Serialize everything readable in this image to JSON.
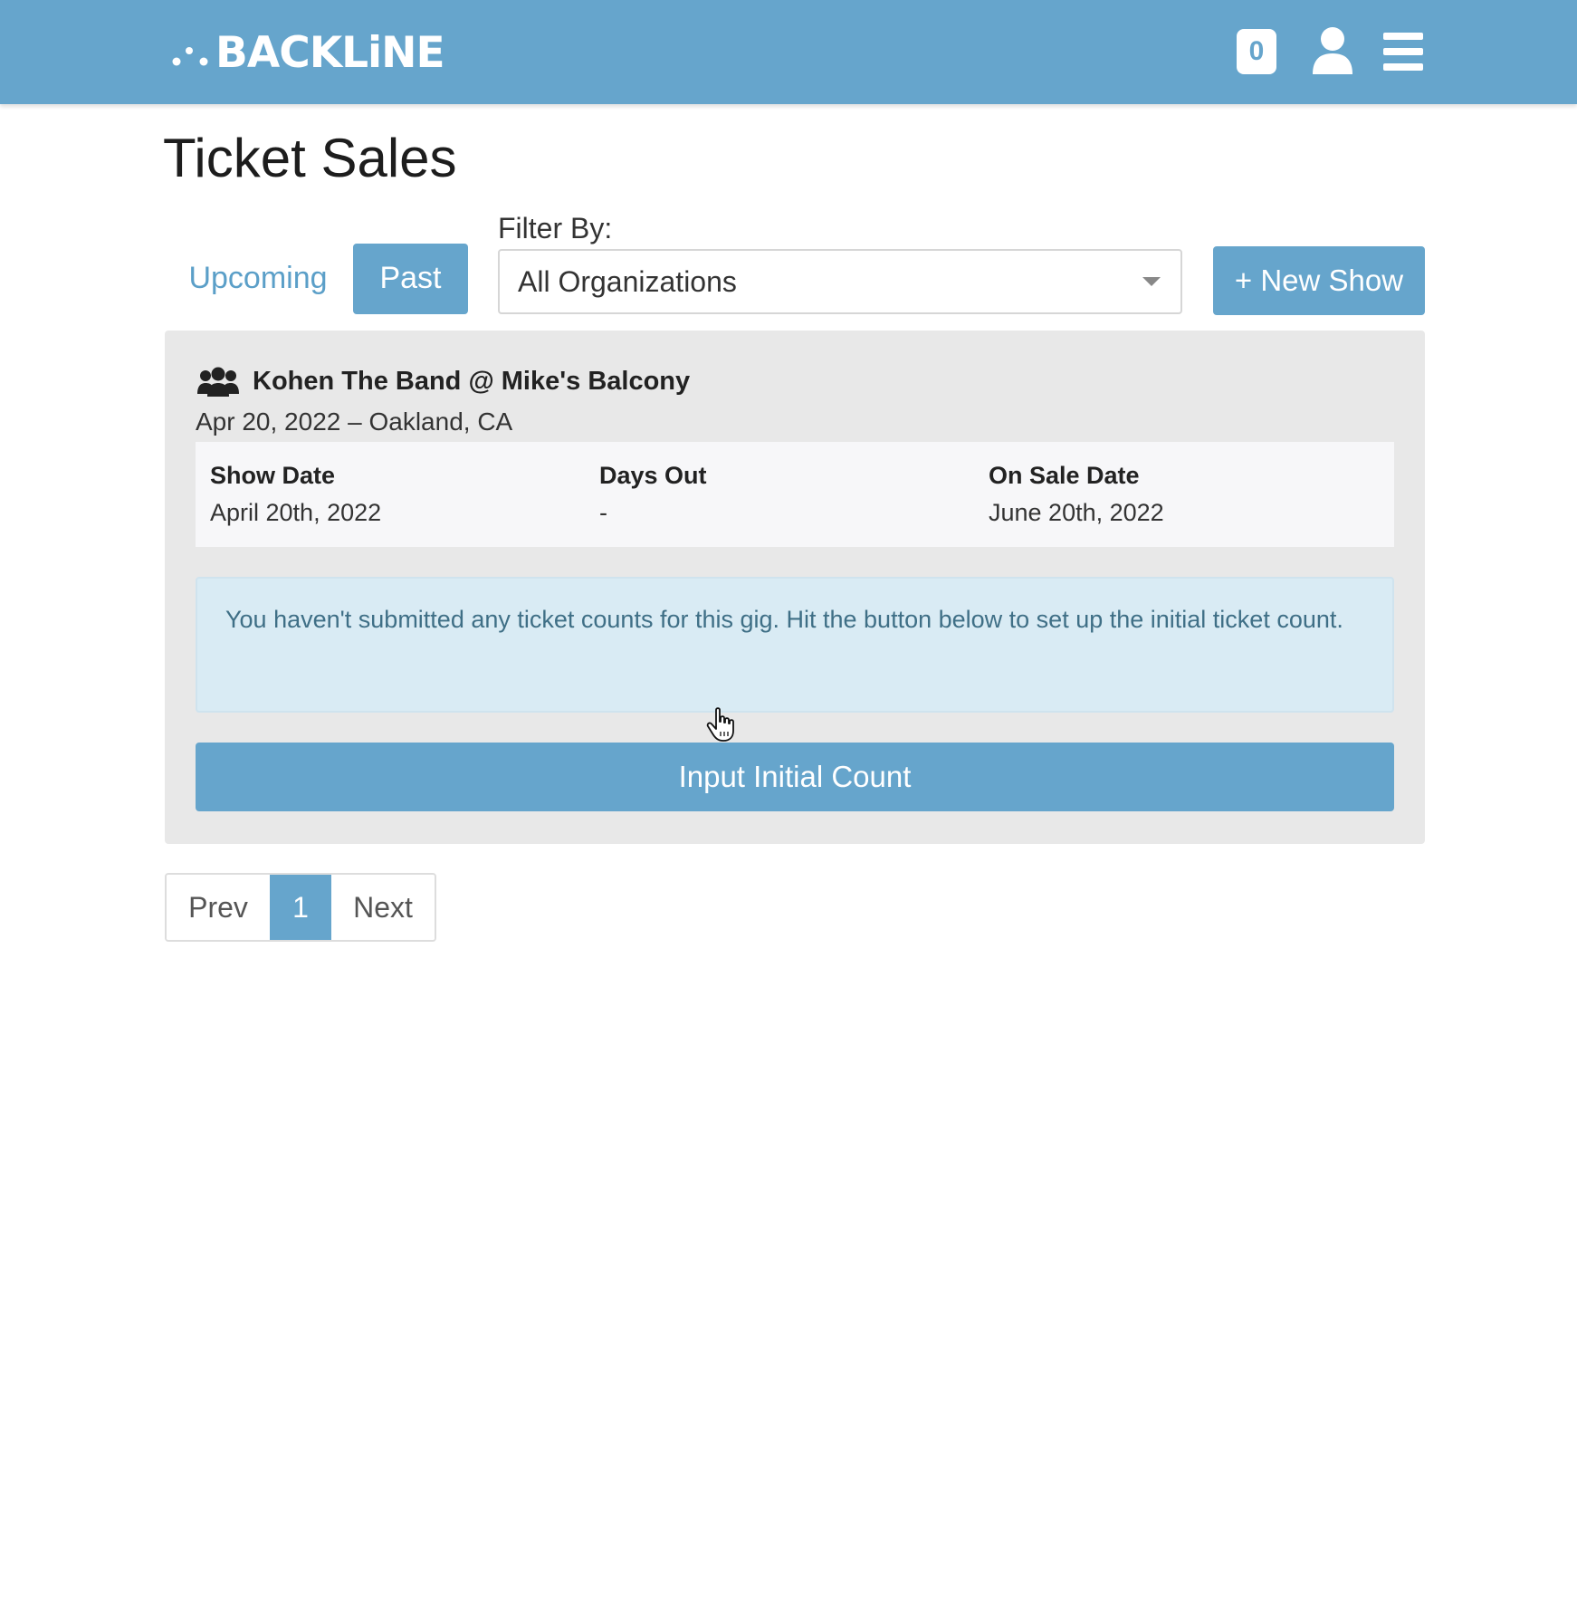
{
  "header": {
    "logo_text": "BACKLiNE",
    "cart_count": "0",
    "icons": {
      "user": "user-icon",
      "menu": "hamburger-menu-icon"
    },
    "bar_color": "#66a5cc"
  },
  "page": {
    "title": "Ticket Sales"
  },
  "tabs": [
    {
      "label": "Upcoming",
      "active": false
    },
    {
      "label": "Past",
      "active": true
    }
  ],
  "filter": {
    "label": "Filter By:",
    "selected": "All Organizations"
  },
  "actions": {
    "new_show": "+ New Show"
  },
  "show": {
    "icon": "group-icon",
    "title": "Kohen The Band @ Mike's Balcony",
    "subtitle": "Apr 20, 2022 – Oakland, CA",
    "columns": [
      {
        "header": "Show Date",
        "value": "April 20th, 2022"
      },
      {
        "header": "Days Out",
        "value": "-"
      },
      {
        "header": "On Sale Date",
        "value": "June 20th, 2022"
      }
    ],
    "alert": "You haven't submitted any ticket counts for this gig. Hit the button below to set up the initial ticket count.",
    "button": "Input Initial Count"
  },
  "pagination": {
    "prev": "Prev",
    "current": "1",
    "next": "Next"
  },
  "colors": {
    "accent": "#66a5cc",
    "card_bg": "#e8e8e8",
    "alert_bg": "#d9ebf4",
    "alert_text": "#3f6f86"
  }
}
